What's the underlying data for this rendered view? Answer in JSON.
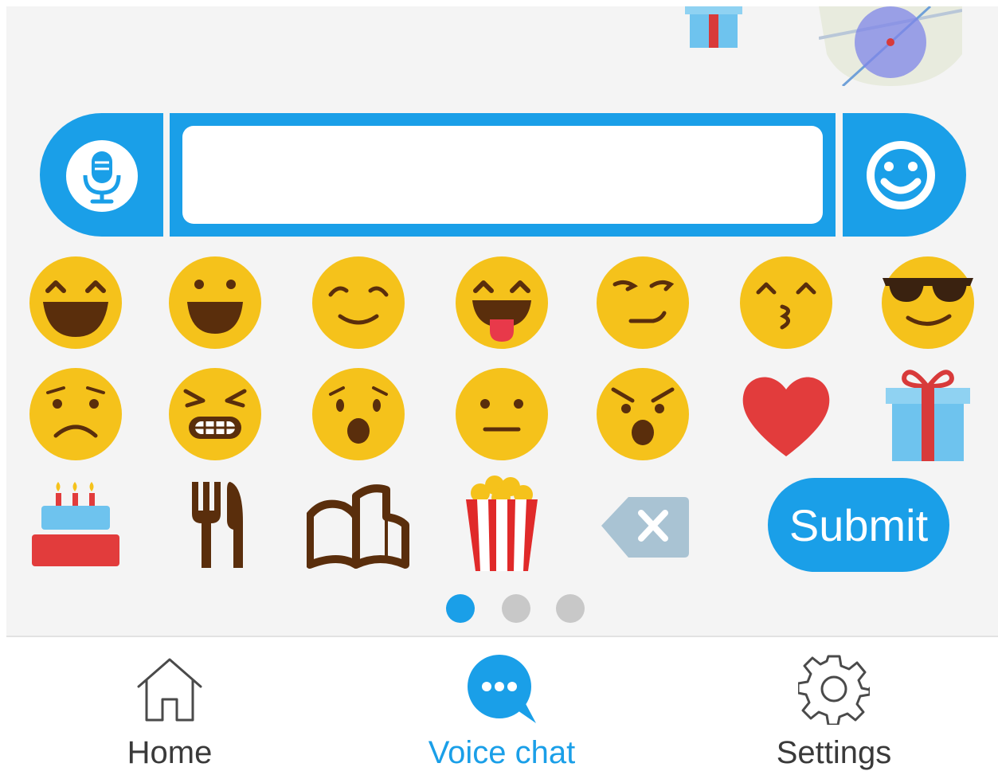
{
  "input": {
    "value": "",
    "placeholder": ""
  },
  "emoji_grid": {
    "row1": [
      "grinning-squint",
      "big-grin",
      "content-smile",
      "tongue-out",
      "smirk",
      "kissing",
      "sunglasses"
    ],
    "row2": [
      "frown",
      "grimace",
      "surprised",
      "neutral",
      "angry-shout",
      "heart",
      "gift"
    ],
    "row3": [
      "birthday-cake",
      "fork-knife",
      "open-book",
      "popcorn",
      "backspace"
    ]
  },
  "submit_label": "Submit",
  "pagination": {
    "pages": 3,
    "current": 1
  },
  "nav": {
    "home": "Home",
    "voice_chat": "Voice chat",
    "settings": "Settings",
    "active": "voice_chat"
  },
  "colors": {
    "accent": "#1a9fe8",
    "emoji_yellow": "#f5c21b",
    "emoji_dark": "#5a2e0c",
    "heart_red": "#e23c3c",
    "panel_bg": "#f4f4f4"
  }
}
